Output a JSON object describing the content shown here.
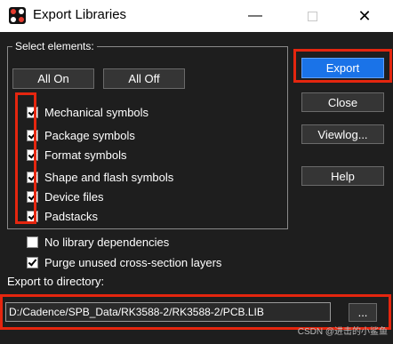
{
  "window": {
    "title": "Export Libraries",
    "close_glyph": "✕",
    "min_glyph": "—"
  },
  "group": {
    "label": "Select elements:"
  },
  "buttons": {
    "all_on": "All On",
    "all_off": "All Off",
    "export": "Export",
    "close": "Close",
    "viewlog": "Viewlog...",
    "help": "Help",
    "browse": "..."
  },
  "elements": [
    {
      "label": "Mechanical symbols",
      "checked": true
    },
    {
      "label": "Package symbols",
      "checked": true
    },
    {
      "label": "Format symbols",
      "checked": true
    },
    {
      "label": "Shape and flash symbols",
      "checked": true
    },
    {
      "label": "Device files",
      "checked": true
    },
    {
      "label": "Padstacks",
      "checked": true
    }
  ],
  "options": [
    {
      "label": "No library dependencies",
      "checked": false
    },
    {
      "label": "Purge unused cross-section layers",
      "checked": true
    }
  ],
  "export_dir": {
    "label": "Export to directory:",
    "value": "D:/Cadence/SPB_Data/RK3588-2/RK3588-2/PCB.LIB"
  },
  "watermark": "CSDN @进击的小鲨鱼",
  "colors": {
    "accent": "#1a73e8",
    "highlight": "#e5260f",
    "background": "#1e1e1e"
  }
}
